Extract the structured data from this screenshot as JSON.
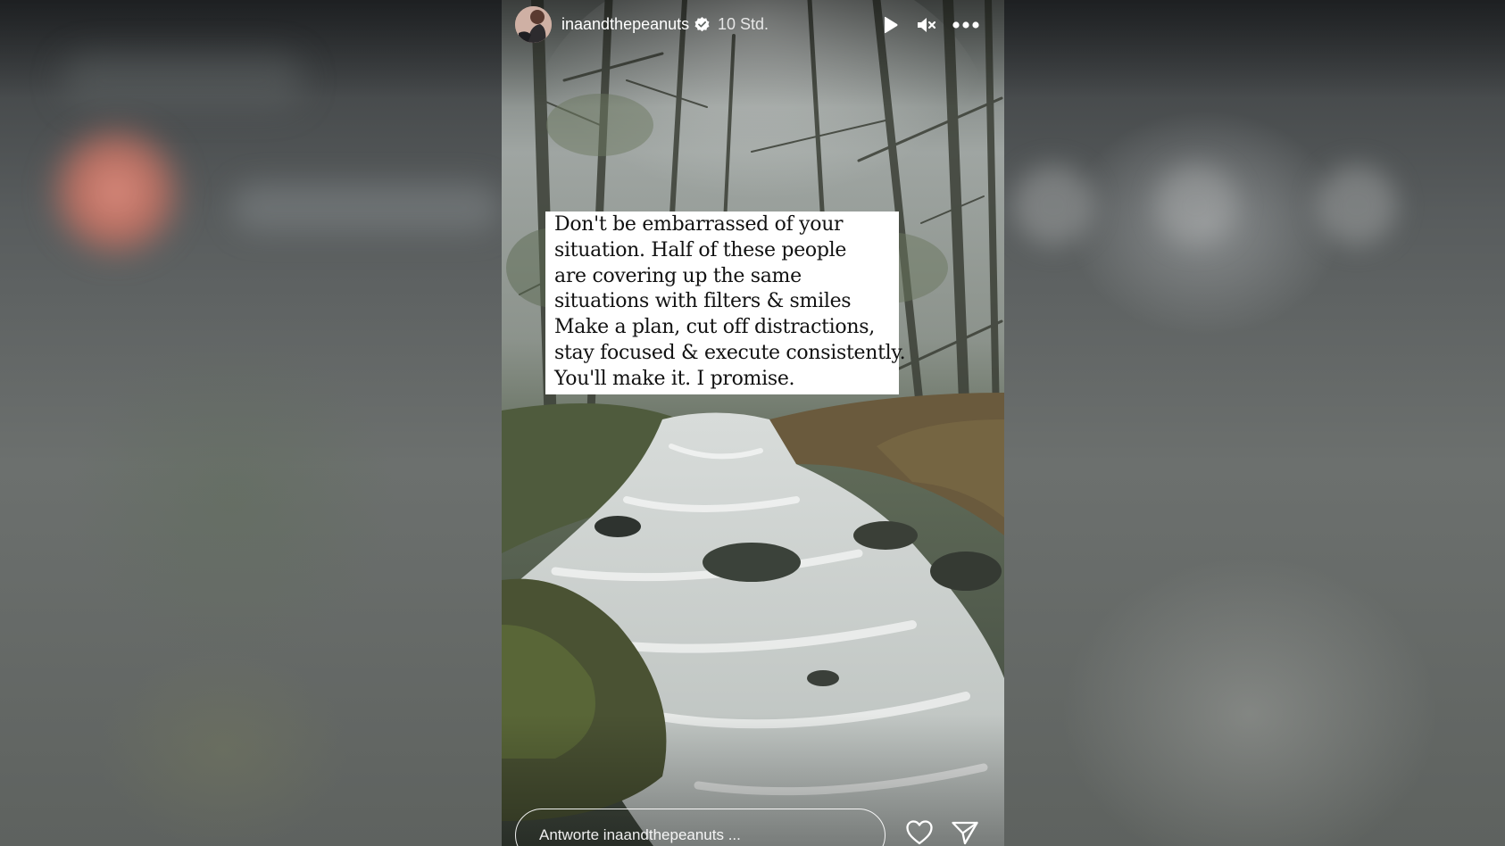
{
  "story": {
    "username": "inaandthepeanuts",
    "time": "10 Std.",
    "verified": true,
    "text_lines": [
      "Don't be embarrassed of your",
      "situation. Half of these people",
      "are covering up the same",
      "situations with filters & smiles",
      "Make a plan, cut off distractions,",
      "stay focused & execute consistently.",
      "You'll make it. I promise."
    ]
  },
  "controls": {
    "play_icon": "play-icon",
    "mute_icon": "speaker-muted-icon",
    "more_icon": "more-horizontal-icon"
  },
  "reply": {
    "placeholder": "Antworte inaandthepeanuts ..."
  },
  "actions": {
    "like_icon": "heart-icon",
    "share_icon": "paper-plane-icon"
  },
  "colors": {
    "text_card_bg": "#ffffff",
    "verified_badge": "#ffffff"
  }
}
